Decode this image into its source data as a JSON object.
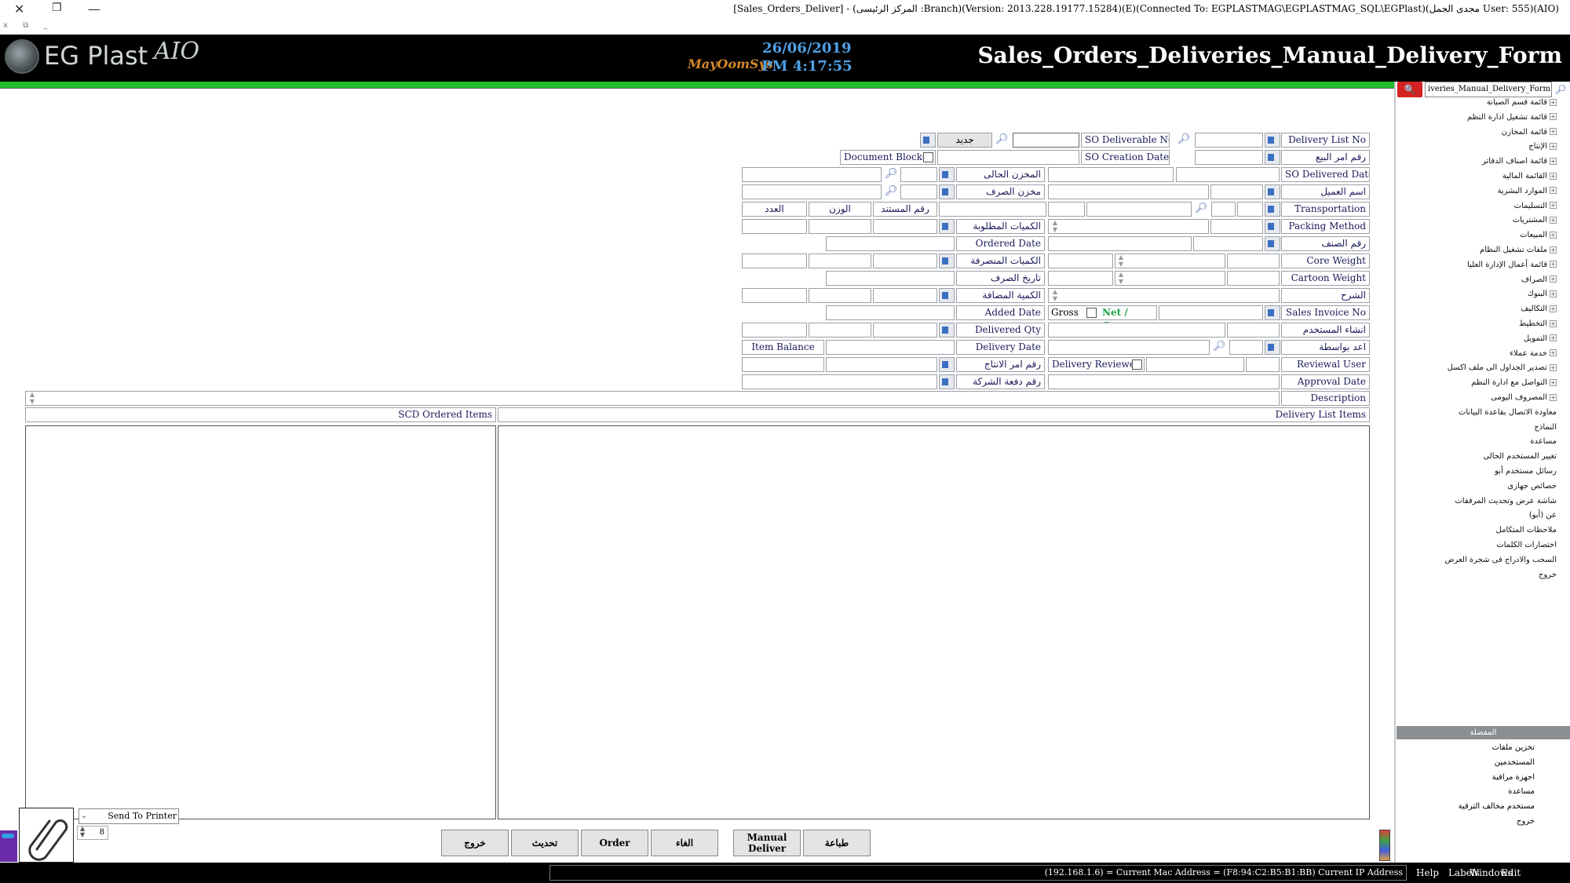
{
  "window": {
    "title": "[Sales_Orders_Deliver] - (المركز الرئيسى :Branch)(Version: 2013.228.19177.15284)(E)(Connected To: EGPLASTMAG\\EGPLASTMAG_SQL\\EGPlast)(مجدى الجمل User: 555)(AIO)",
    "close": "✕",
    "restore": "❐",
    "minimize": "—",
    "mini_menu": "x ⧉ _"
  },
  "header": {
    "logo_text": "EG Plast",
    "aio": "AIO",
    "brand": "MayOomSys",
    "date": "26/06/2019",
    "time": "PM 4:17:55",
    "form_title": "Sales_Orders_Deliveries_Manual_Delivery_Form"
  },
  "form": {
    "delivery_list_no": "Delivery List No",
    "so_order_no": "رقم امر البيع",
    "so_delivered_date": "SO Delivered Date",
    "customer_name": "اسم العميل",
    "transportation": "Transportation",
    "packing_method": "Packing Method",
    "item_no": "رقم الصنف",
    "core_weight": "Core Weight",
    "cartoon_weight": "Cartoon Weight",
    "explanation": "الشرح",
    "sales_invoice_no": "Sales Invoice No",
    "created_by_user": "انشاء المستخدم",
    "prepared_by": "اعد بواسطة",
    "reviewal_user": "Reviewal User",
    "approval_date": "Approval Date",
    "description": "Description",
    "so_deliverable_no": "SO Deliverable No",
    "so_creation_date": "SO Creation Date",
    "new_btn": "جديد",
    "document_blocked": "Document Blocked",
    "current_store": "المخزن الحالى",
    "issue_store": "مخزن الصرف",
    "doc_no": "رقم المستند",
    "weight": "الوزن",
    "count": "العدد",
    "required_qty": "الكميات المطلوبة",
    "ordered_date": "Ordered Date",
    "issued_qty": "الكميات المنصرفة",
    "issue_date": "تاريخ الصرف",
    "added_qty": "الكمية المضافة",
    "added_date": "Added Date",
    "gross": "Gross",
    "net_gross": "Net / Gross",
    "delivered_qty": "Delivered Qty",
    "delivery_date": "Delivery Date",
    "item_balance": "Item Balance",
    "production_order_no": "رقم امر الانتاج",
    "delivery_reviewed": "Delivery Reviewed",
    "company_batch_no": "رقم دفعة الشركة"
  },
  "panels": {
    "scd_ordered_items": "SCD Ordered Items",
    "delivery_list_items": "Delivery List Items"
  },
  "buttons": {
    "exit": "خروج",
    "refresh": "تحديث",
    "order": "Order",
    "cancel": "الغاء",
    "manual_deliver_1": "Manual",
    "manual_deliver_2": "Deliver",
    "print": "طباعة"
  },
  "printer": {
    "label": "Send To Printer",
    "copies": "8"
  },
  "sidebar": {
    "search_value": "iveries_Manual_Delivery_Form",
    "search_icon": "🔍",
    "tree": [
      "قائمة قسم الصيانة",
      "قائمة تشغيل ادارة النظم",
      "قائمة المخازن",
      "الإنتاج",
      "قائمة اصناف الدفاتر",
      "القائمة المالية",
      "الموارد البشرية",
      "التسليمات",
      "المشتريات",
      "المبيعات",
      "ملفات تشغيل النظام",
      "قائمة أعمال الإدارة العليا",
      "الصراف",
      "البنوك",
      "التكاليف",
      "التخطيط",
      "التمويل",
      "خدمة عملاء",
      "تصدير الجداول الى ملف اكسل",
      "التواصل مع ادارة النظم",
      "المصروف اليومى",
      "معاودة الاتصال بقاعدة البيانات",
      "النماذج",
      "مساعدة",
      "تغيير المستخدم الحالى",
      "رسائل مستخدم أبو",
      "خصائص جهازى",
      "شاشة عرض وتحديث المرفقات",
      "عن (أبو)",
      "ملاحظات المتكامل",
      "اختصارات الكلمات",
      "السحب والادراج فى شجرة العرض",
      "خروج"
    ],
    "favorites_title": "المفضلة",
    "favorites": [
      "تخزين ملفات",
      "المستخدمين",
      "اجهزة مراقبة",
      "مساعدة",
      "مستخدم مخالف الترقية",
      "خروج"
    ]
  },
  "statusbar": {
    "ip_text": "(192.168.1.6) = Current Mac Address = (F8:94:C2:B5:B1:BB) Current IP Address",
    "help": "Help",
    "labels": "Labels",
    "edit": "Edit",
    "windows": "Windows"
  }
}
